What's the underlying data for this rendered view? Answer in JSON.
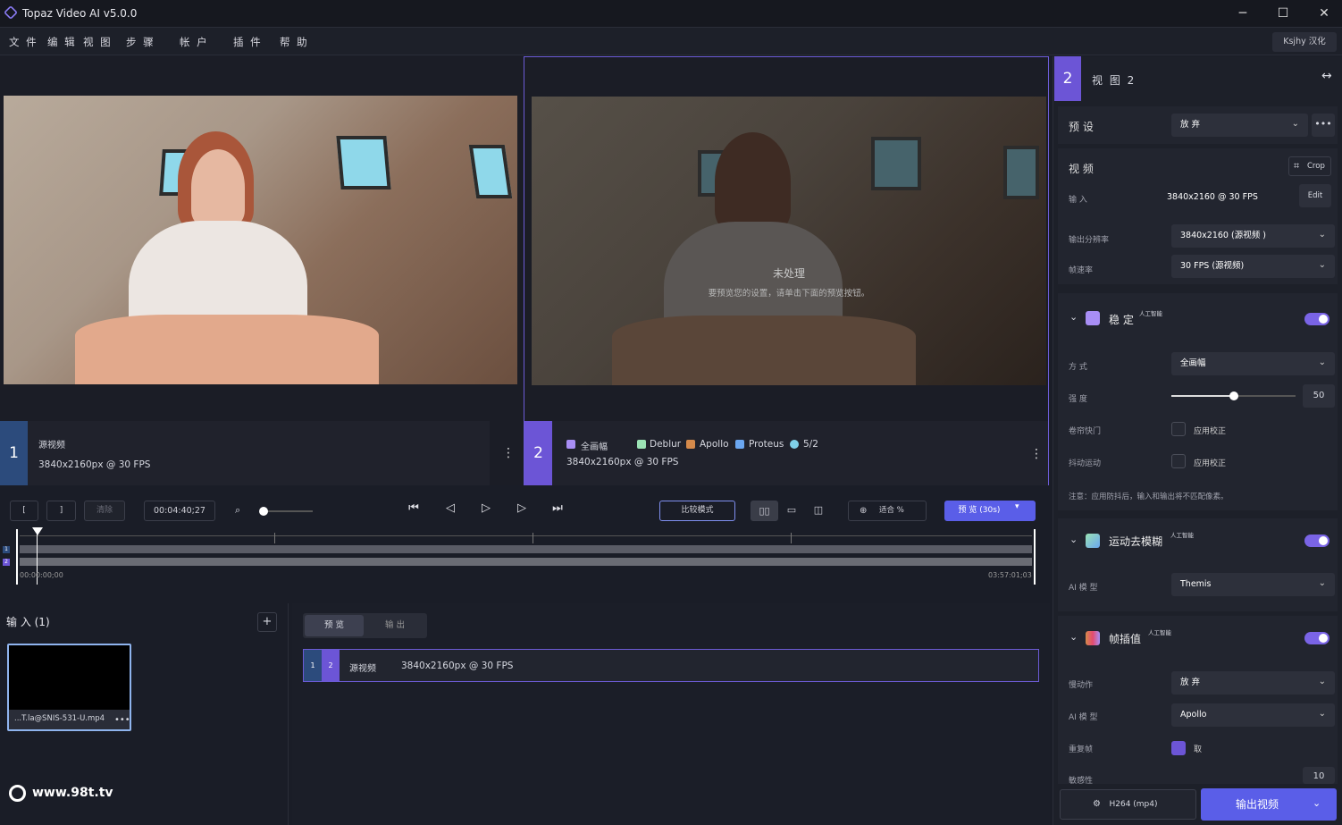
{
  "titlebar": {
    "title": "Topaz Video AI  v5.0.0"
  },
  "menu": {
    "items": [
      "文 件",
      "编 辑",
      "视 图",
      "步 骤",
      "帐 户",
      "插 件",
      "帮 助"
    ],
    "localize_label": "Ksjhy 汉化"
  },
  "left_view": {
    "num": "1",
    "name": "源视频",
    "spec": "3840x2160px @ 30 FPS"
  },
  "right_view": {
    "num": "2",
    "overlay_title": "未处理",
    "overlay_hint": "要预览您的设置，请单击下面的预览按钮。",
    "models": [
      "全画幅",
      "Deblur",
      "Apollo",
      "Proteus",
      "5/2"
    ],
    "spec": "3840x2160px @ 30 FPS"
  },
  "controls": {
    "in_mark": "[",
    "out_mark": "]",
    "clear": "清除",
    "timecode": "00:04:40;27",
    "compare": "比较模式",
    "zoom": "适合 %",
    "preview": "预 览 (30s)"
  },
  "timeline": {
    "start": "00:00:00;00",
    "end": "03:57:01;03"
  },
  "inputs": {
    "title": "输 入 (1)",
    "file": "...T.la@SNIS-531-U.mp4"
  },
  "queue": {
    "tabs": [
      "预 览",
      "输 出"
    ],
    "row_a": "1",
    "row_b": "2",
    "row_name": "源视频",
    "row_spec": "3840x2160px @ 30 FPS"
  },
  "panel": {
    "num": "2",
    "title": "视 图 2",
    "preset_label": "预 设",
    "preset_value": "放 弃",
    "video_label": "视 频",
    "crop": "Crop",
    "input_label": "输 入",
    "input_value": "3840x2160 @ 30 FPS",
    "edit": "Edit",
    "outres_label": "输出分辨率",
    "outres_value": "3840x2160 (源视频 )",
    "fps_label": "帧速率",
    "fps_value": "30 FPS (源视频)",
    "stab": {
      "title": "稳 定",
      "badge": "人工智能",
      "mode_label": "方 式",
      "mode_value": "全画幅",
      "strength_label": "强 度",
      "strength_value": "50",
      "rolling_label": "卷帘快门",
      "rolling_check": "应用校正",
      "jitter_label": "抖动运动",
      "jitter_check": "应用校正",
      "note": "注意：应用防抖后，输入和输出将不匹配像素。"
    },
    "deblur": {
      "title": "运动去模糊",
      "badge": "人工智能",
      "model_label": "AI 模 型",
      "model_value": "Themis"
    },
    "interp": {
      "title": "帧插值",
      "badge": "人工智能",
      "slow_label": "慢动作",
      "slow_value": "放 弃",
      "model_label": "AI 模 型",
      "model_value": "Apollo",
      "dup_label": "重复帧",
      "dup_check": "取",
      "sens_label": "敏感性",
      "sens_value": "10"
    },
    "codec": "H264 (mp4)",
    "export": "输出视频"
  },
  "watermarks": {
    "site": "www.98t.tv"
  }
}
